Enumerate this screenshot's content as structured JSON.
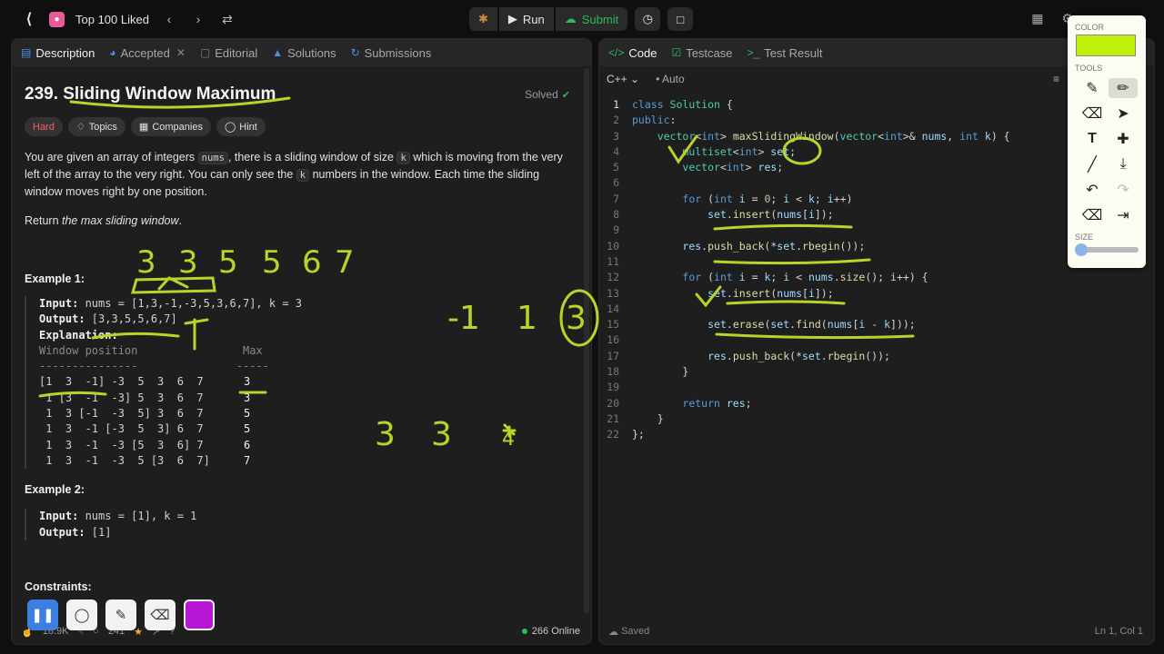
{
  "topbar": {
    "list_title": "Top 100 Liked",
    "run_label": "Run",
    "submit_label": "Submit"
  },
  "left_tabs": [
    {
      "label": "Description"
    },
    {
      "label": "Accepted"
    },
    {
      "label": "Editorial"
    },
    {
      "label": "Solutions"
    },
    {
      "label": "Submissions"
    }
  ],
  "problem": {
    "title": "239. Sliding Window Maximum",
    "status": "Solved",
    "difficulty": "Hard",
    "chips": [
      "Topics",
      "Companies",
      "Hint"
    ],
    "p1_a": "You are given an array of integers ",
    "p1_code1": "nums",
    "p1_b": ", there is a sliding window of size ",
    "p1_code2": "k",
    "p1_c": " which is moving from the very left of the array to the very right. You can only see the ",
    "p1_code3": "k",
    "p1_d": " numbers in the window. Each time the sliding window moves right by one position.",
    "p2_a": "Return ",
    "p2_em": "the max sliding window",
    "p2_b": ".",
    "ex1_title": "Example 1:",
    "ex1_input_label": "Input:",
    "ex1_input": " nums = [1,3,-1,-3,5,3,6,7], k = 3",
    "ex1_output_label": "Output:",
    "ex1_output": " [3,3,5,5,6,7]",
    "ex1_expl_label": "Explanation:",
    "ex1_header": "Window position                Max",
    "ex1_dashes": "---------------               -----",
    "ex1_rows": [
      {
        "win": "[1  3  -1] -3  5  3  6  7",
        "max": "3"
      },
      {
        "win": " 1 [3  -1  -3] 5  3  6  7",
        "max": "3"
      },
      {
        "win": " 1  3 [-1  -3  5] 3  6  7",
        "max": "5"
      },
      {
        "win": " 1  3  -1 [-3  5  3] 6  7",
        "max": "5"
      },
      {
        "win": " 1  3  -1  -3 [5  3  6] 7",
        "max": "6"
      },
      {
        "win": " 1  3  -1  -3  5 [3  6  7]",
        "max": "7"
      }
    ],
    "ex2_title": "Example 2:",
    "ex2_input_label": "Input:",
    "ex2_input": " nums = [1], k = 1",
    "ex2_output_label": "Output:",
    "ex2_output": " [1]",
    "constraints_title": "Constraints:"
  },
  "left_footer": {
    "likes": "18.9K",
    "comments": "241",
    "online": "266 Online"
  },
  "right_tabs": [
    {
      "label": "Code"
    },
    {
      "label": "Testcase"
    },
    {
      "label": "Test Result"
    }
  ],
  "editor": {
    "language": "C++",
    "mode": "Auto",
    "saved": "Saved",
    "cursor": "Ln 1, Col 1",
    "lines": [
      "class Solution {",
      "public:",
      "    vector<int> maxSlidingWindow(vector<int>& nums, int k) {",
      "        multiset<int> set;",
      "        vector<int> res;",
      "",
      "        for (int i = 0; i < k; i++)",
      "            set.insert(nums[i]);",
      "",
      "        res.push_back(*set.rbegin());",
      "",
      "        for (int i = k; i < nums.size(); i++) {",
      "            set.insert(nums[i]);",
      "",
      "            set.erase(set.find(nums[i - k]));",
      "",
      "            res.push_back(*set.rbegin());",
      "        }",
      "",
      "        return res;",
      "    }",
      "};"
    ]
  },
  "toolbox": {
    "color_label": "COLOR",
    "tools_label": "TOOLS",
    "size_label": "SIZE",
    "current_color": "#bff00a"
  },
  "recorder": {
    "current_color": "#b716d4"
  },
  "annotations": {
    "ink_color": "#b8d42a",
    "row_top": [
      "3",
      "3",
      "5",
      "5",
      "6",
      "7"
    ],
    "mid": [
      "-1",
      "1",
      "3"
    ],
    "low": [
      "3",
      "3",
      "4"
    ]
  }
}
